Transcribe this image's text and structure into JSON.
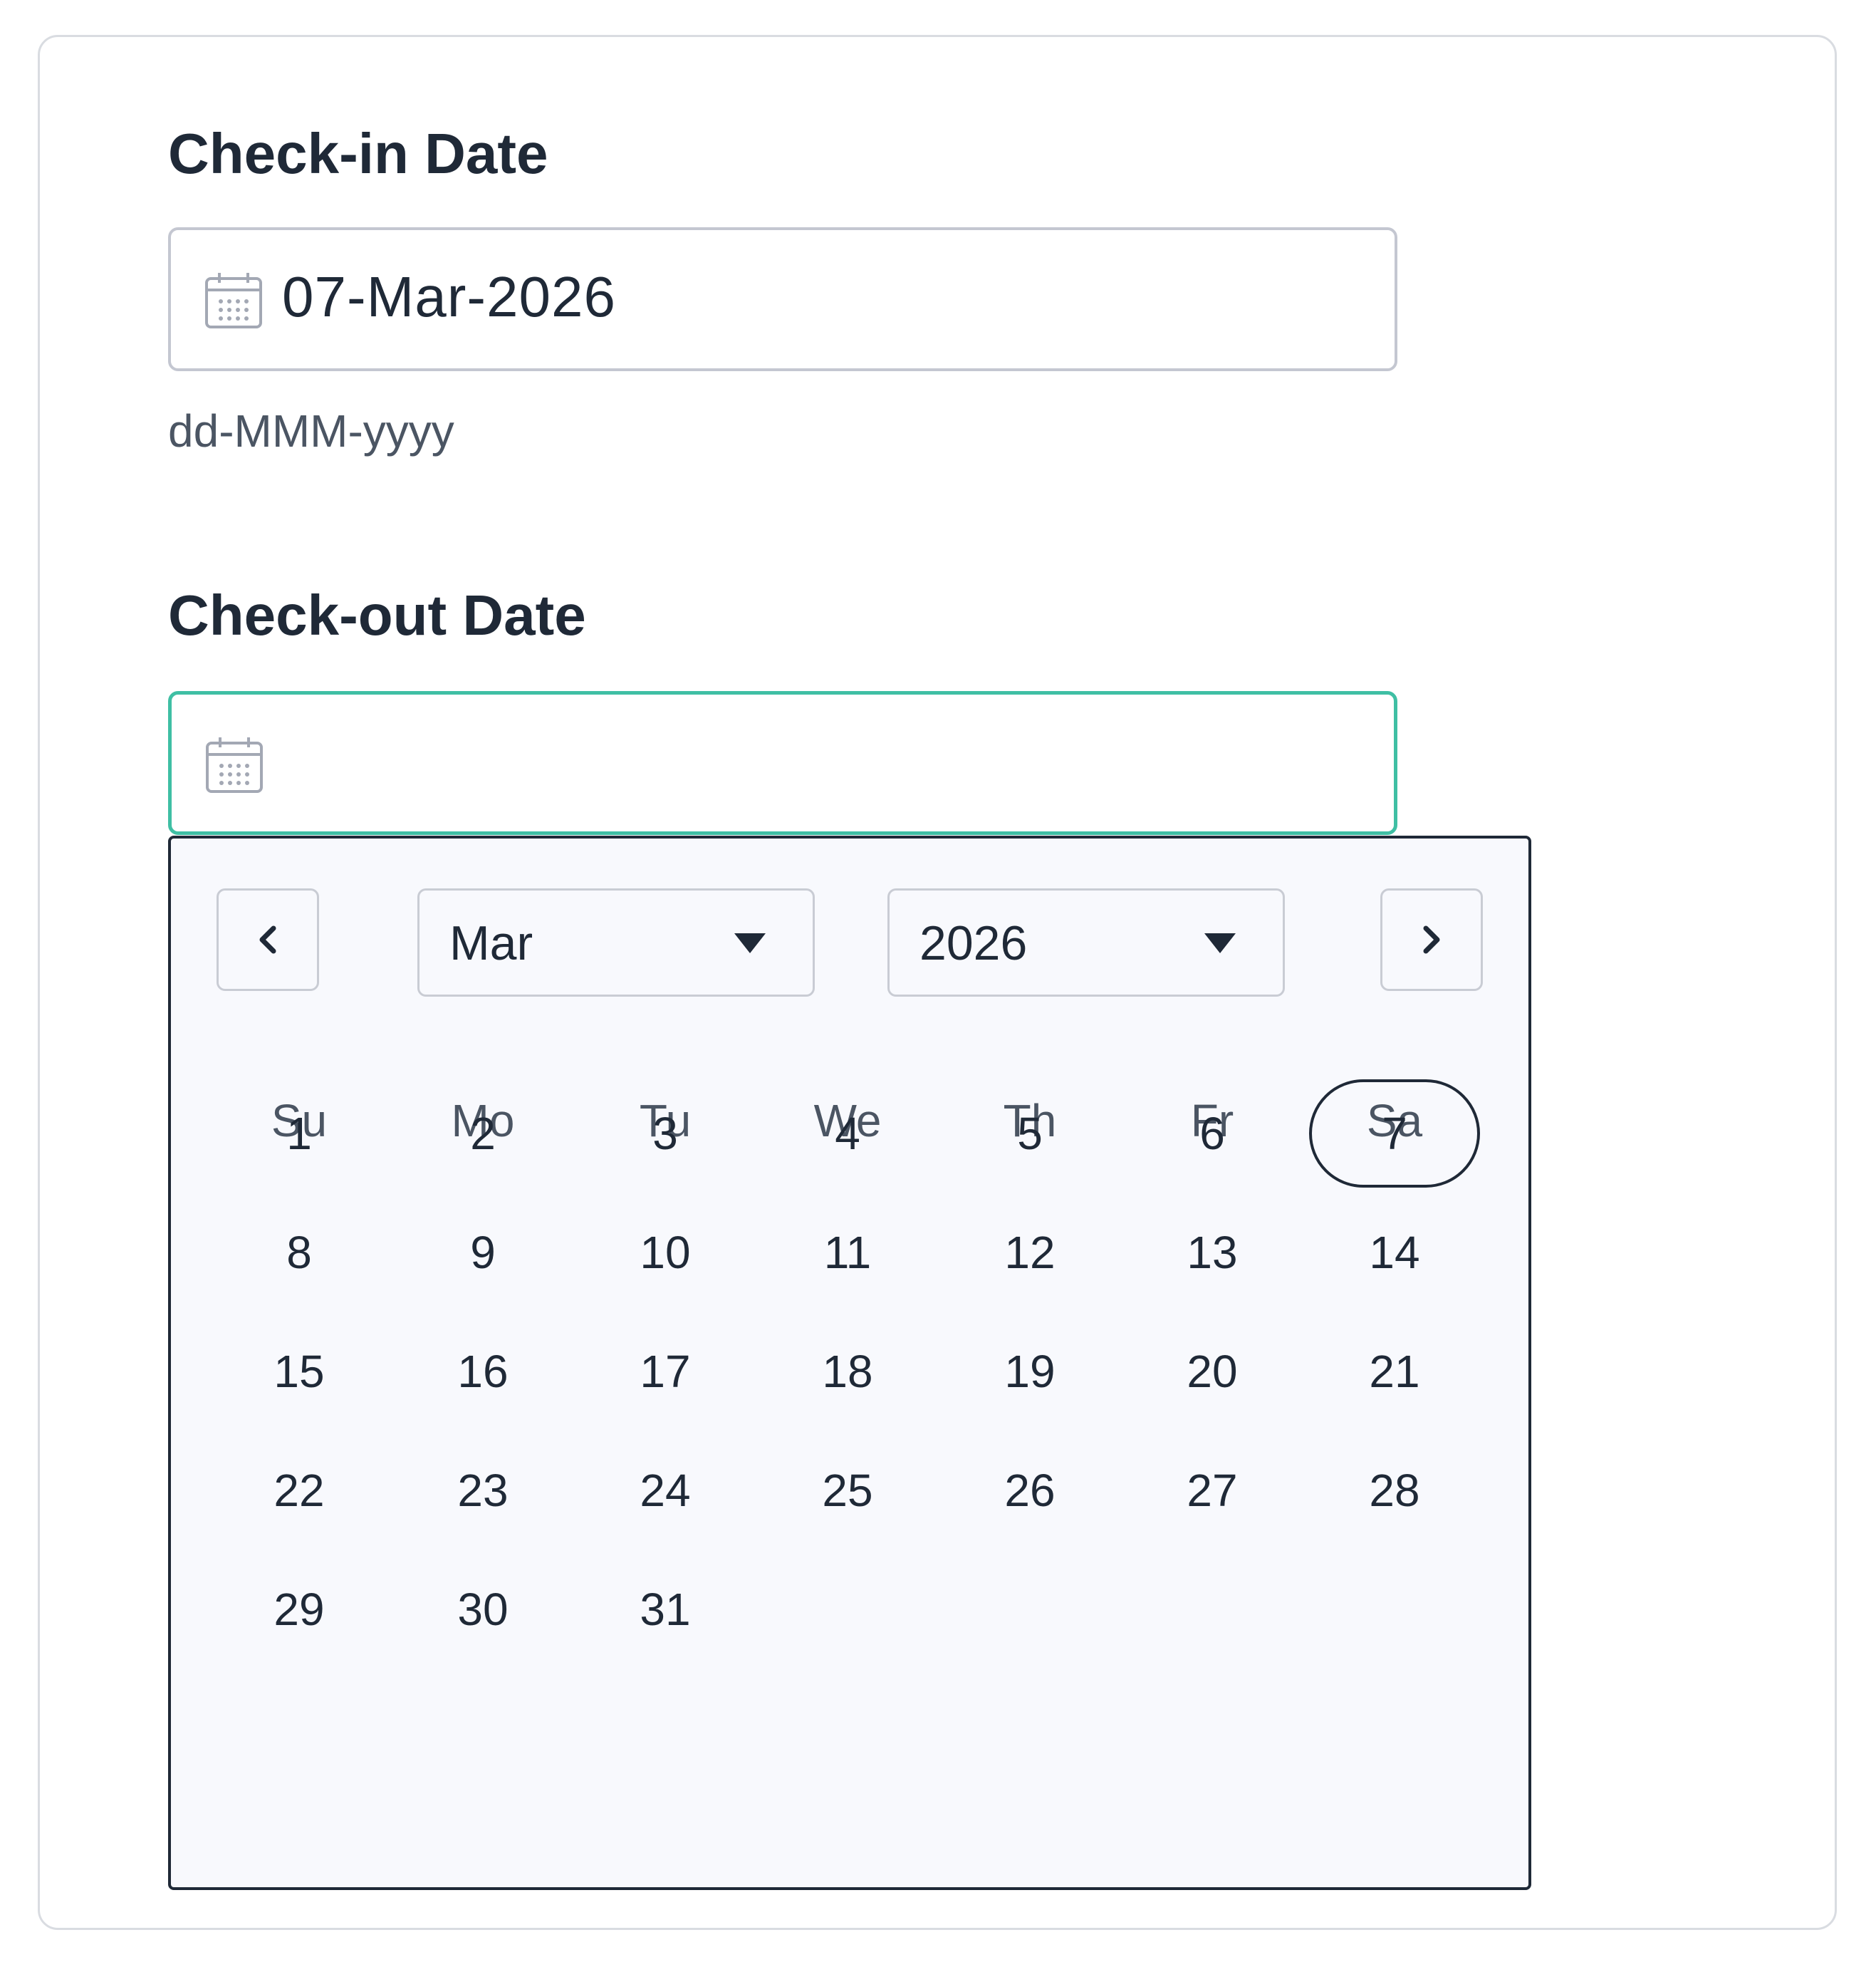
{
  "checkin": {
    "label": "Check-in Date",
    "value": "07-Mar-2026",
    "hint": "dd-MMM-yyyy"
  },
  "checkout": {
    "label": "Check-out Date",
    "value": ""
  },
  "datepicker": {
    "month": "Mar",
    "year": "2026",
    "weekdays": [
      "Su",
      "Mo",
      "Tu",
      "We",
      "Th",
      "Fr",
      "Sa"
    ],
    "weeks": [
      [
        "1",
        "2",
        "3",
        "4",
        "5",
        "6",
        "7"
      ],
      [
        "8",
        "9",
        "10",
        "11",
        "12",
        "13",
        "14"
      ],
      [
        "15",
        "16",
        "17",
        "18",
        "19",
        "20",
        "21"
      ],
      [
        "22",
        "23",
        "24",
        "25",
        "26",
        "27",
        "28"
      ],
      [
        "29",
        "30",
        "31"
      ]
    ],
    "selected_day": "7"
  },
  "colors": {
    "focus_border": "#3fbfa4",
    "text": "#1f2937",
    "popup_bg": "#f8f9fd"
  }
}
